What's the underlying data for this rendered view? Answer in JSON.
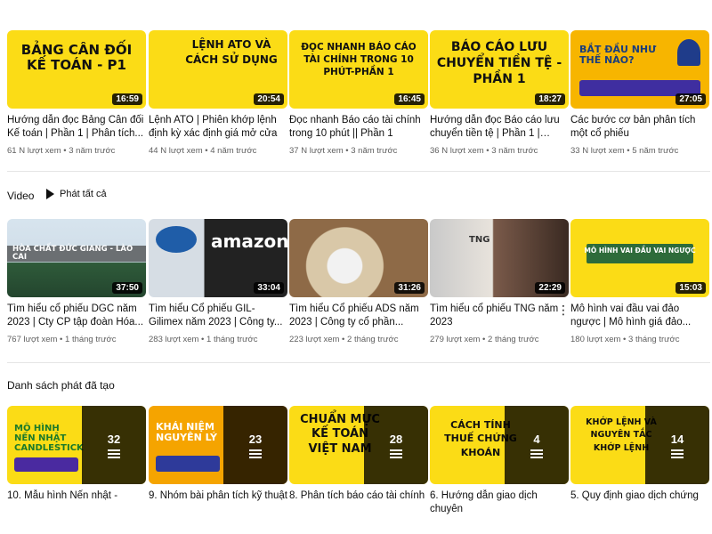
{
  "row1": [
    {
      "thumb_text": "BẢNG CÂN ĐỐI KẾ TOÁN - P1",
      "duration": "16:59",
      "title": "Hướng dẫn đọc Bảng Cân đối Kế toán | Phần 1 | Phân tích...",
      "meta": "61 N lượt xem • 3 năm trước"
    },
    {
      "thumb_text": "LỆNH ATO VÀ CÁCH SỬ DỤNG",
      "duration": "20:54",
      "title": "Lệnh ATO | Phiên khớp lệnh định kỳ xác định giá mở cửa",
      "meta": "44 N lượt xem • 4 năm trước"
    },
    {
      "thumb_text": "ĐỌC NHANH BÁO CÁO TÀI CHÍNH TRONG 10 PHÚT-PHẦN 1",
      "duration": "16:45",
      "title": "Đọc nhanh Báo cáo tài chính trong 10 phút || Phần 1",
      "meta": "37 N lượt xem • 3 năm trước"
    },
    {
      "thumb_text": "BÁO CÁO LƯU CHUYỂN TIỀN TỆ - PHẦN 1",
      "duration": "18:27",
      "title": "Hướng dẫn đọc Báo cáo lưu chuyển tiền tệ | Phần 1 | Phâ...",
      "meta": "36 N lượt xem • 3 năm trước"
    },
    {
      "thumb_text": "BẮT ĐẦU NHƯ THẾ NÀO?",
      "duration": "27:05",
      "title": "Các bước cơ bản phân tích một cổ phiếu",
      "meta": "33 N lượt xem • 5 năm trước"
    }
  ],
  "video_section": {
    "title": "Video",
    "play_all": "Phát tất cả"
  },
  "row2": [
    {
      "thumb_text": "HÒA CHẤT ĐỨC GIANG - LÀO CAI",
      "duration": "37:50",
      "title": "Tìm hiểu cổ phiếu DGC năm 2023 | Cty CP tập đoàn Hóa...",
      "meta": "767 lượt xem • 1 tháng trước"
    },
    {
      "thumb_text": "amazon",
      "duration": "33:04",
      "title": "Tìm hiểu Cổ phiếu GIL- Gilimex năm 2023 | Công ty...",
      "meta": "283 lượt xem • 1 tháng trước"
    },
    {
      "thumb_text": "",
      "duration": "31:26",
      "title": "Tìm hiểu Cổ phiếu ADS năm 2023 | Công ty cổ phần...",
      "meta": "223 lượt xem • 2 tháng trước"
    },
    {
      "thumb_text": "TNG",
      "duration": "22:29",
      "title": "Tìm hiểu cổ phiếu TNG năm 2023",
      "meta": "279 lượt xem • 2 tháng trước"
    },
    {
      "thumb_text": "MÔ HÌNH VAI ĐẦU VAI NGƯỢC",
      "duration": "15:03",
      "title": "Mô hình vai đầu vai đảo ngược | Mô hình giá đảo...",
      "meta": "180 lượt xem • 3 tháng trước"
    }
  ],
  "playlist_section": {
    "title": "Danh sách phát đã tạo"
  },
  "row3": [
    {
      "thumb_text": "MÔ HÌNH NẾN NHẬT CANDLESTICK",
      "count": "32",
      "title": "10. Mẫu hình Nến nhật -"
    },
    {
      "thumb_text": "KHÁI NIỆM NGUYÊN LÝ",
      "count": "23",
      "title": "9. Nhóm bài phân tích kỹ thuật"
    },
    {
      "thumb_text": "CHUẨN MỰC KẾ TOÁN VIỆT NAM",
      "count": "28",
      "title": "8. Phân tích báo cáo tài chính"
    },
    {
      "thumb_text": "CÁCH TÍNH THUẾ CHỨNG KHOÁN",
      "count": "4",
      "title": "6. Hướng dẫn giao dịch chuyên"
    },
    {
      "thumb_text": "KHỚP LỆNH VÀ NGUYÊN TẮC KHỚP LỆNH",
      "count": "14",
      "title": "5. Quy định giao dịch chứng"
    }
  ]
}
